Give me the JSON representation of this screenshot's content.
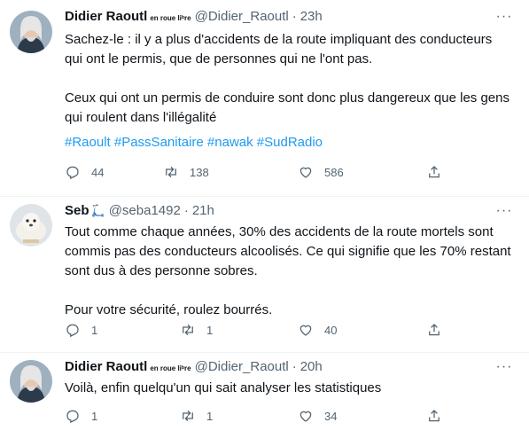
{
  "tweets": [
    {
      "name": "Didier Raoutl",
      "name_sub": "en roue liᵇre",
      "handle": "@Didier_Raoutl",
      "time": "23h",
      "text": "Sachez-le : il y a plus d'accidents de la route impliquant des conducteurs qui ont le permis, que de personnes qui ne l'ont pas.\n\nCeux qui ont un permis de conduire sont donc plus dangereux que les gens qui roulent dans l'illégalité",
      "hashtags": "#Raoult #PassSanitaire #nawak #SudRadio",
      "replies": "44",
      "retweets": "138",
      "likes": "586"
    },
    {
      "name": "Seb",
      "name_emoji": "🛴",
      "handle": "@seba1492",
      "time": "21h",
      "text": "Tout comme chaque années, 30% des accidents de la route mortels sont commis pas des conducteurs alcoolisés. Ce qui signifie que les 70% restant sont dus à des personne sobres.\n\nPour votre sécurité, roulez bourrés.",
      "replies": "1",
      "retweets": "1",
      "likes": "40"
    },
    {
      "name": "Didier Raoutl",
      "name_sub": "en roue liᵇre",
      "handle": "@Didier_Raoutl",
      "time": "20h",
      "text": "Voilà, enfin quelqu'un qui sait analyser les statistiques",
      "replies": "1",
      "retweets": "1",
      "likes": "34"
    }
  ],
  "dot": "·",
  "more_glyph": "···"
}
